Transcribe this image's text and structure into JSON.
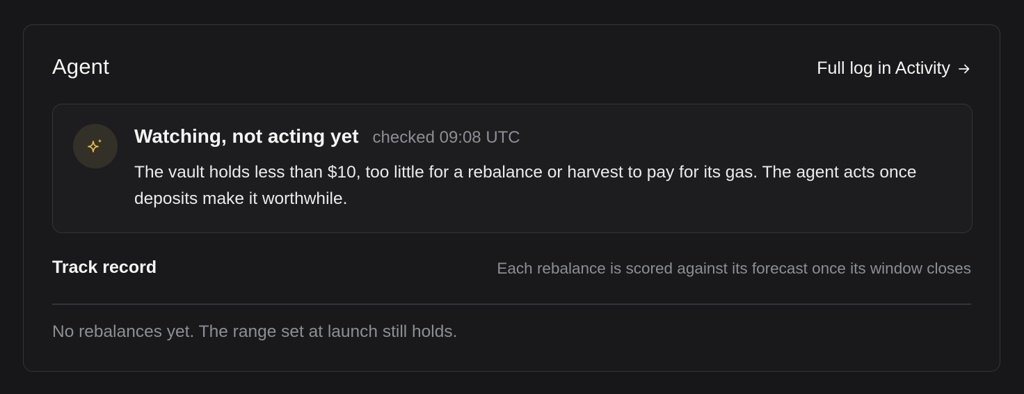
{
  "agent_panel": {
    "title": "Agent",
    "activity_link": {
      "label": "Full log in Activity",
      "icon": "arrow-right-icon"
    },
    "status": {
      "icon": "sparkles-icon",
      "accent_color": "#e8b94a",
      "title": "Watching, not acting yet",
      "checked": "checked 09:08 UTC",
      "description": "The vault holds less than $10, too little for a rebalance or harvest to pay for its gas. The agent acts once deposits make it worthwhile."
    },
    "track_record": {
      "title": "Track record",
      "note": "Each rebalance is scored against its forecast once its window closes",
      "empty_text": "No rebalances yet. The range set at launch still holds."
    }
  }
}
